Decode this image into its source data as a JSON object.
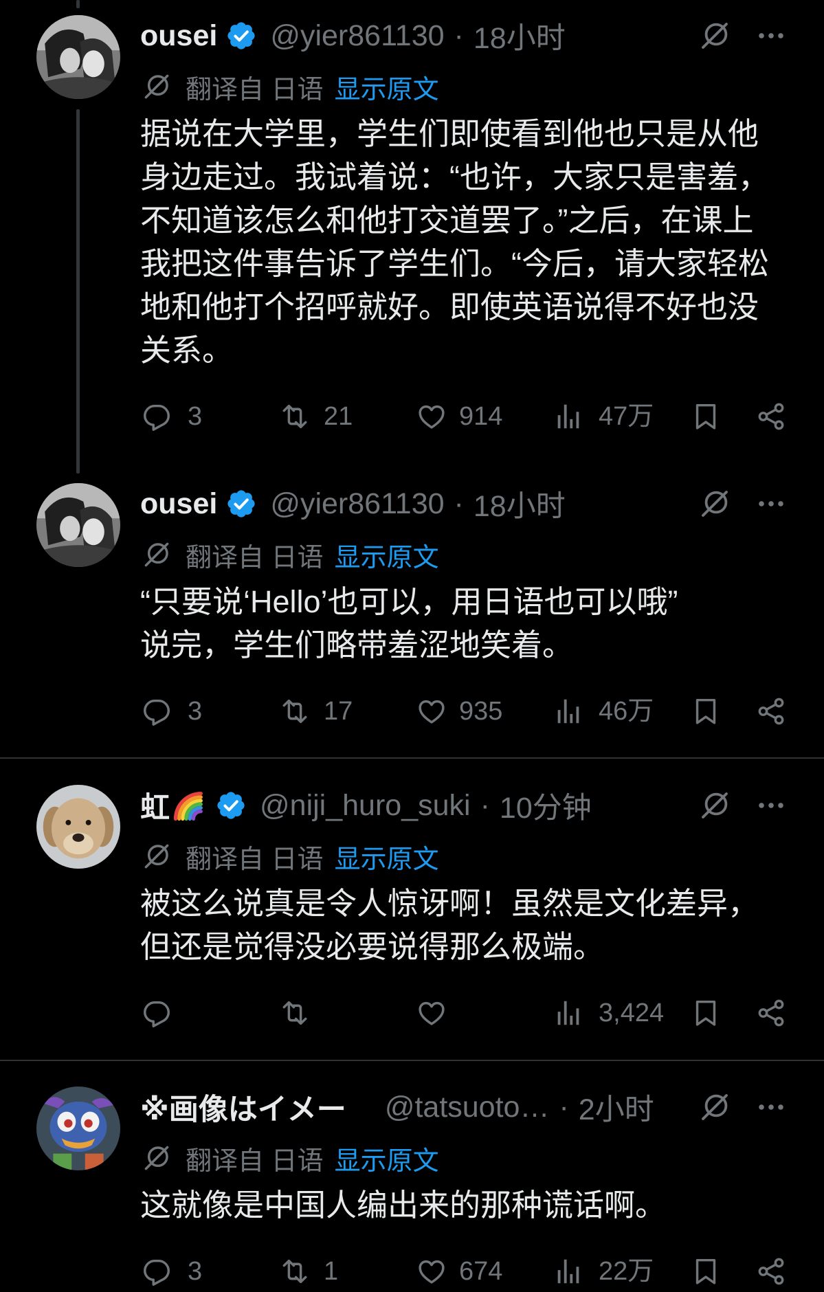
{
  "colors": {
    "background": "#000000",
    "text": "#e7e9ea",
    "muted": "#71767b",
    "accent": "#1d9bf0",
    "divider": "#2f3336",
    "thread_line": "#333639"
  },
  "icons": {
    "verified": "verified-badge-icon",
    "grok": "grok-icon",
    "more": "more-dots-icon",
    "translate": "grok-translate-icon",
    "reply": "reply-icon",
    "repost": "repost-icon",
    "like": "heart-icon",
    "views": "views-chart-icon",
    "bookmark": "bookmark-icon",
    "share": "share-icon",
    "emoji": "rainbow-icon"
  },
  "tweets": [
    {
      "name": "ousei",
      "verified": true,
      "handle": "@yier861130",
      "separator": "·",
      "time": "18小时",
      "translation": {
        "label": "翻译自 日语",
        "link": "显示原文"
      },
      "body": "据说在大学里，学生们即使看到他也只是从他\n身边走过。我试着说：“也许，大家只是害羞，\n不知道该怎么和他打交道罢了。”之后，在课上\n我把这件事告诉了学生们。“今后，请大家轻松\n地和他打个招呼就好。即使英语说得不好也没\n关系。",
      "actions": {
        "replies": "3",
        "reposts": "21",
        "likes": "914",
        "views": "47万"
      }
    },
    {
      "name": "ousei",
      "verified": true,
      "handle": "@yier861130",
      "separator": "·",
      "time": "18小时",
      "translation": {
        "label": "翻译自 日语",
        "link": "显示原文"
      },
      "body": "“只要说‘Hello’也可以，用日语也可以哦”\n说完，学生们略带羞涩地笑着。",
      "actions": {
        "replies": "3",
        "reposts": "17",
        "likes": "935",
        "views": "46万"
      }
    },
    {
      "name": "虹",
      "verified": true,
      "handle": "@niji_huro_suki",
      "separator": "·",
      "time": "10分钟",
      "translation": {
        "label": "翻译自 日语",
        "link": "显示原文"
      },
      "body": "被这么说真是令人惊讶啊！虽然是文化差异，\n但还是觉得没必要说得那么极端。",
      "actions": {
        "views": "3,424"
      }
    },
    {
      "name": "※画像はイメー",
      "verified": false,
      "handle": "@tatsuoto…",
      "separator": "·",
      "time": "2小时",
      "translation": {
        "label": "翻译自 日语",
        "link": "显示原文"
      },
      "body": "这就像是中国人编出来的那种谎话啊。",
      "actions": {
        "replies": "3",
        "reposts": "1",
        "likes": "674",
        "views": "22万"
      }
    }
  ]
}
